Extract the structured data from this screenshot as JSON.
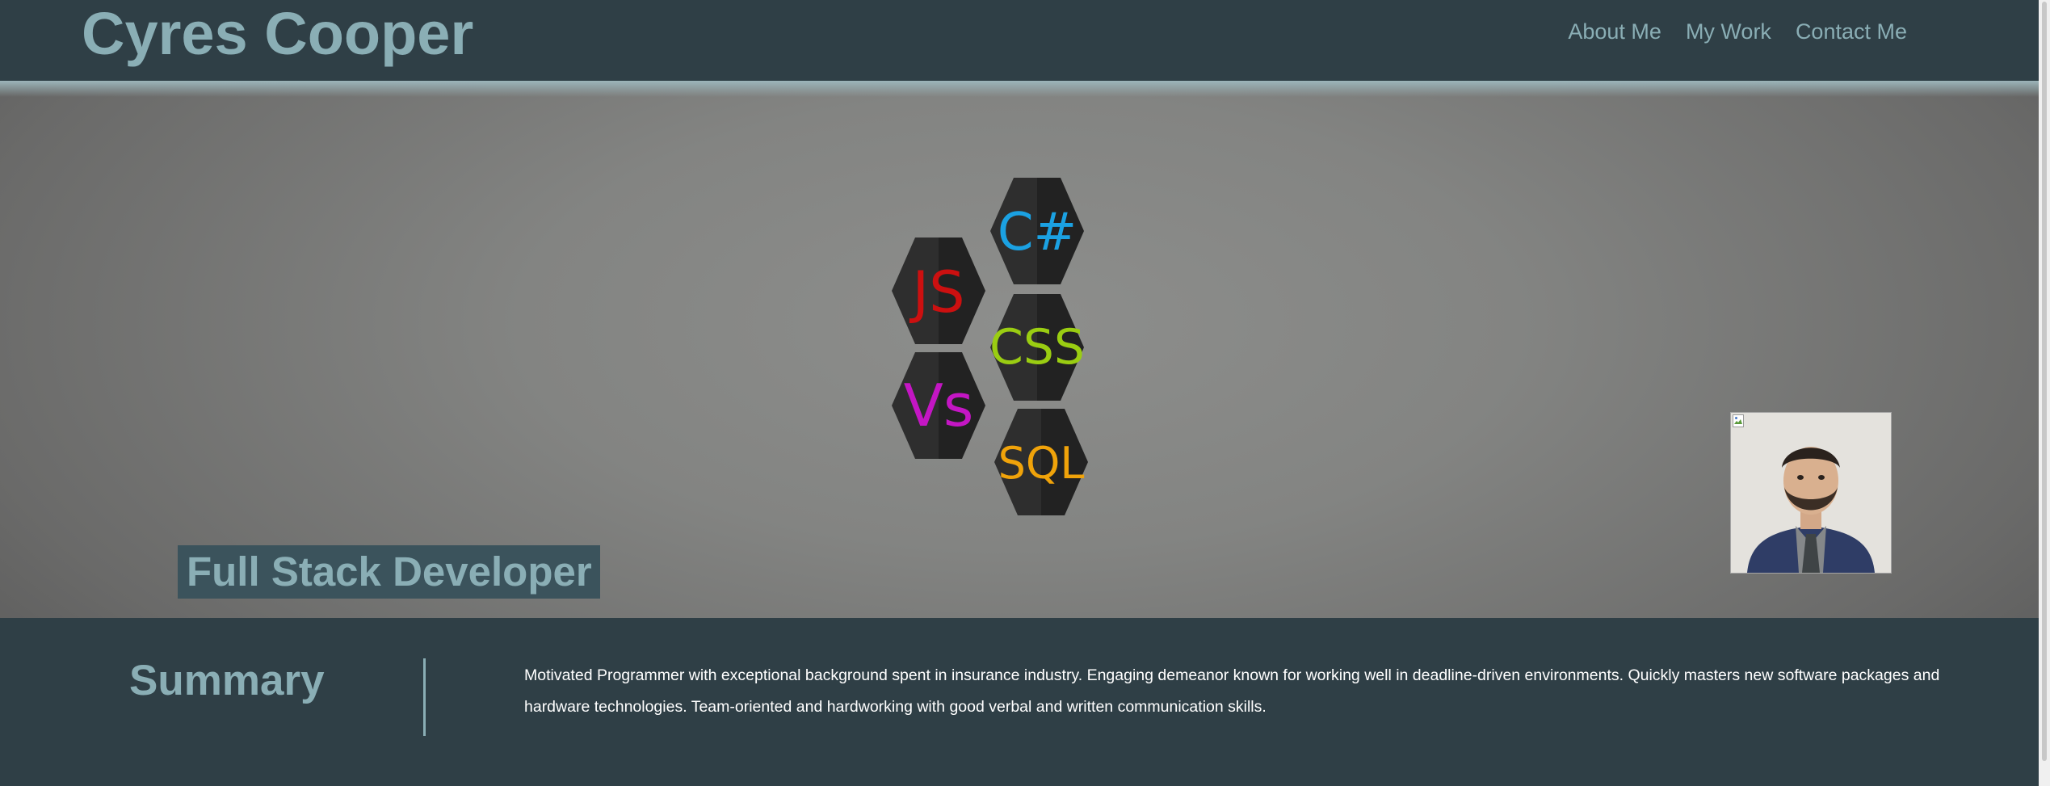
{
  "header": {
    "title": "Cyres Cooper",
    "nav": [
      "About Me",
      "My Work",
      "Contact Me"
    ]
  },
  "hero": {
    "skills": [
      {
        "label": "C#",
        "color": "#1ba1e2"
      },
      {
        "label": "JS",
        "color": "#cc1010"
      },
      {
        "label": "CSS",
        "color": "#9acd12"
      },
      {
        "label": "Vs",
        "color": "#c416c4"
      },
      {
        "label": "SQL",
        "color": "#f0a30a"
      }
    ],
    "role": "Full Stack Developer"
  },
  "summary": {
    "heading": "Summary",
    "text": "Motivated Programmer with exceptional background spent in insurance industry. Engaging demeanor known for working well in deadline-driven environments. Quickly masters new software packages and hardware technologies. Team-oriented and hardworking with good verbal and written communication skills."
  },
  "colors": {
    "dark_bg": "#2f3f46",
    "accent": "#8aaeb5",
    "badge_bg": "#3b535c",
    "hex_fill": "#2b2b2b"
  }
}
